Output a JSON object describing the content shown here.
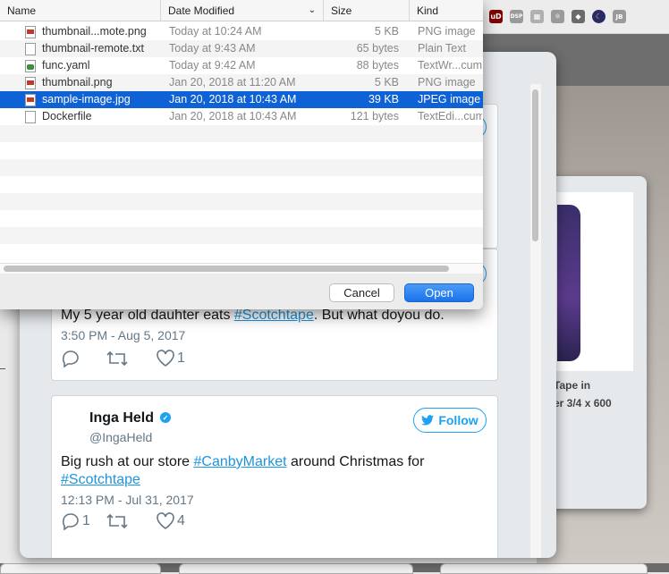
{
  "dialog": {
    "columns": {
      "name": "Name",
      "date": "Date Modified",
      "size": "Size",
      "kind": "Kind"
    },
    "files": [
      {
        "name": "thumbnail...mote.png",
        "date": "Today at 10:24 AM",
        "size": "5 KB",
        "kind": "PNG image",
        "icon": "image-file-icon"
      },
      {
        "name": "thumbnail-remote.txt",
        "date": "Today at 9:43 AM",
        "size": "65 bytes",
        "kind": "Plain Text",
        "icon": "text-file-icon"
      },
      {
        "name": "func.yaml",
        "date": "Today at 9:42 AM",
        "size": "88 bytes",
        "kind": "TextWr...cum",
        "icon": "yaml-file-icon"
      },
      {
        "name": "thumbnail.png",
        "date": "Jan 20, 2018 at 11:20 AM",
        "size": "5 KB",
        "kind": "PNG image",
        "icon": "image-file-icon"
      },
      {
        "name": "sample-image.jpg",
        "date": "Jan 20, 2018 at 10:43 AM",
        "size": "39 KB",
        "kind": "JPEG image",
        "icon": "image-file-icon",
        "selected": true
      },
      {
        "name": "Dockerfile",
        "date": "Jan 20, 2018 at 10:43 AM",
        "size": "121 bytes",
        "kind": "TextEdi...cum",
        "icon": "text-file-icon"
      }
    ],
    "cancel_label": "Cancel",
    "open_label": "Open"
  },
  "tweets": [
    {
      "text_prefix": "My 5 year old dauhter eats ",
      "hashtag": "#Scotchtape",
      "text_suffix": ". But what doyou do.",
      "time": "3:50 PM - Aug 5, 2017",
      "likes": "1"
    },
    {
      "name": "Inga Held",
      "handle": "@IngaHeld",
      "follow_label": "Follow",
      "text_prefix": "Big rush at our store ",
      "hashtag1": "#CanbyMarket",
      "text_middle": " around Christmas for",
      "hashtag2": "#Scotchtape",
      "time": "12:13 PM - Jul 31, 2017",
      "replies": "1",
      "likes": "4"
    }
  ],
  "side_card": {
    "caption_line1": "Tape in",
    "caption_line2": "er 3/4 x 600"
  },
  "extensions": [
    "ublock-icon",
    "dsp-icon",
    "grid-icon",
    "react-icon",
    "shield-icon",
    "moon-icon",
    "jb-icon"
  ],
  "ext_labels": {
    "ublock": "uD",
    "dsp": "DSP",
    "jb": "JB"
  }
}
